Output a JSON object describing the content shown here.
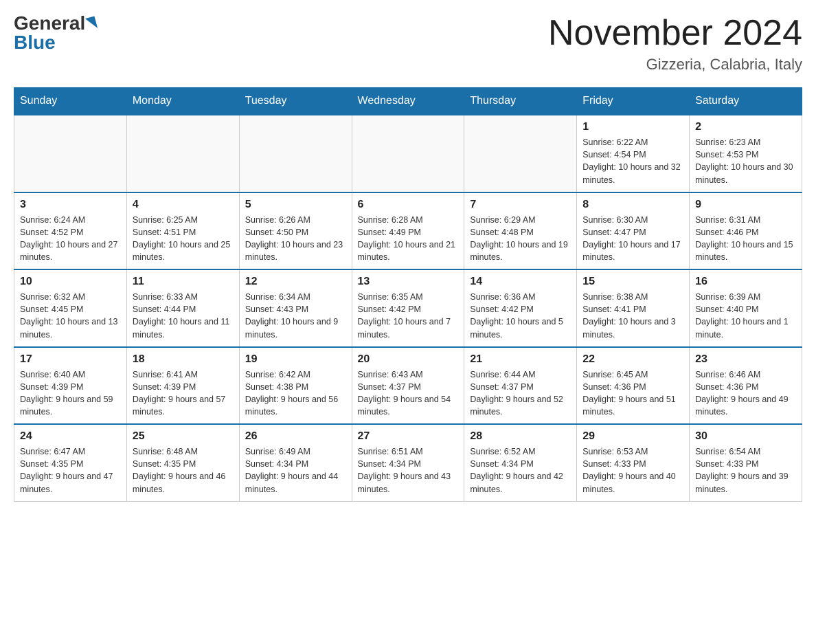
{
  "header": {
    "logo_general": "General",
    "logo_blue": "Blue",
    "month_title": "November 2024",
    "location": "Gizzeria, Calabria, Italy"
  },
  "weekdays": [
    "Sunday",
    "Monday",
    "Tuesday",
    "Wednesday",
    "Thursday",
    "Friday",
    "Saturday"
  ],
  "weeks": [
    [
      {
        "day": "",
        "info": ""
      },
      {
        "day": "",
        "info": ""
      },
      {
        "day": "",
        "info": ""
      },
      {
        "day": "",
        "info": ""
      },
      {
        "day": "",
        "info": ""
      },
      {
        "day": "1",
        "info": "Sunrise: 6:22 AM\nSunset: 4:54 PM\nDaylight: 10 hours and 32 minutes."
      },
      {
        "day": "2",
        "info": "Sunrise: 6:23 AM\nSunset: 4:53 PM\nDaylight: 10 hours and 30 minutes."
      }
    ],
    [
      {
        "day": "3",
        "info": "Sunrise: 6:24 AM\nSunset: 4:52 PM\nDaylight: 10 hours and 27 minutes."
      },
      {
        "day": "4",
        "info": "Sunrise: 6:25 AM\nSunset: 4:51 PM\nDaylight: 10 hours and 25 minutes."
      },
      {
        "day": "5",
        "info": "Sunrise: 6:26 AM\nSunset: 4:50 PM\nDaylight: 10 hours and 23 minutes."
      },
      {
        "day": "6",
        "info": "Sunrise: 6:28 AM\nSunset: 4:49 PM\nDaylight: 10 hours and 21 minutes."
      },
      {
        "day": "7",
        "info": "Sunrise: 6:29 AM\nSunset: 4:48 PM\nDaylight: 10 hours and 19 minutes."
      },
      {
        "day": "8",
        "info": "Sunrise: 6:30 AM\nSunset: 4:47 PM\nDaylight: 10 hours and 17 minutes."
      },
      {
        "day": "9",
        "info": "Sunrise: 6:31 AM\nSunset: 4:46 PM\nDaylight: 10 hours and 15 minutes."
      }
    ],
    [
      {
        "day": "10",
        "info": "Sunrise: 6:32 AM\nSunset: 4:45 PM\nDaylight: 10 hours and 13 minutes."
      },
      {
        "day": "11",
        "info": "Sunrise: 6:33 AM\nSunset: 4:44 PM\nDaylight: 10 hours and 11 minutes."
      },
      {
        "day": "12",
        "info": "Sunrise: 6:34 AM\nSunset: 4:43 PM\nDaylight: 10 hours and 9 minutes."
      },
      {
        "day": "13",
        "info": "Sunrise: 6:35 AM\nSunset: 4:42 PM\nDaylight: 10 hours and 7 minutes."
      },
      {
        "day": "14",
        "info": "Sunrise: 6:36 AM\nSunset: 4:42 PM\nDaylight: 10 hours and 5 minutes."
      },
      {
        "day": "15",
        "info": "Sunrise: 6:38 AM\nSunset: 4:41 PM\nDaylight: 10 hours and 3 minutes."
      },
      {
        "day": "16",
        "info": "Sunrise: 6:39 AM\nSunset: 4:40 PM\nDaylight: 10 hours and 1 minute."
      }
    ],
    [
      {
        "day": "17",
        "info": "Sunrise: 6:40 AM\nSunset: 4:39 PM\nDaylight: 9 hours and 59 minutes."
      },
      {
        "day": "18",
        "info": "Sunrise: 6:41 AM\nSunset: 4:39 PM\nDaylight: 9 hours and 57 minutes."
      },
      {
        "day": "19",
        "info": "Sunrise: 6:42 AM\nSunset: 4:38 PM\nDaylight: 9 hours and 56 minutes."
      },
      {
        "day": "20",
        "info": "Sunrise: 6:43 AM\nSunset: 4:37 PM\nDaylight: 9 hours and 54 minutes."
      },
      {
        "day": "21",
        "info": "Sunrise: 6:44 AM\nSunset: 4:37 PM\nDaylight: 9 hours and 52 minutes."
      },
      {
        "day": "22",
        "info": "Sunrise: 6:45 AM\nSunset: 4:36 PM\nDaylight: 9 hours and 51 minutes."
      },
      {
        "day": "23",
        "info": "Sunrise: 6:46 AM\nSunset: 4:36 PM\nDaylight: 9 hours and 49 minutes."
      }
    ],
    [
      {
        "day": "24",
        "info": "Sunrise: 6:47 AM\nSunset: 4:35 PM\nDaylight: 9 hours and 47 minutes."
      },
      {
        "day": "25",
        "info": "Sunrise: 6:48 AM\nSunset: 4:35 PM\nDaylight: 9 hours and 46 minutes."
      },
      {
        "day": "26",
        "info": "Sunrise: 6:49 AM\nSunset: 4:34 PM\nDaylight: 9 hours and 44 minutes."
      },
      {
        "day": "27",
        "info": "Sunrise: 6:51 AM\nSunset: 4:34 PM\nDaylight: 9 hours and 43 minutes."
      },
      {
        "day": "28",
        "info": "Sunrise: 6:52 AM\nSunset: 4:34 PM\nDaylight: 9 hours and 42 minutes."
      },
      {
        "day": "29",
        "info": "Sunrise: 6:53 AM\nSunset: 4:33 PM\nDaylight: 9 hours and 40 minutes."
      },
      {
        "day": "30",
        "info": "Sunrise: 6:54 AM\nSunset: 4:33 PM\nDaylight: 9 hours and 39 minutes."
      }
    ]
  ]
}
